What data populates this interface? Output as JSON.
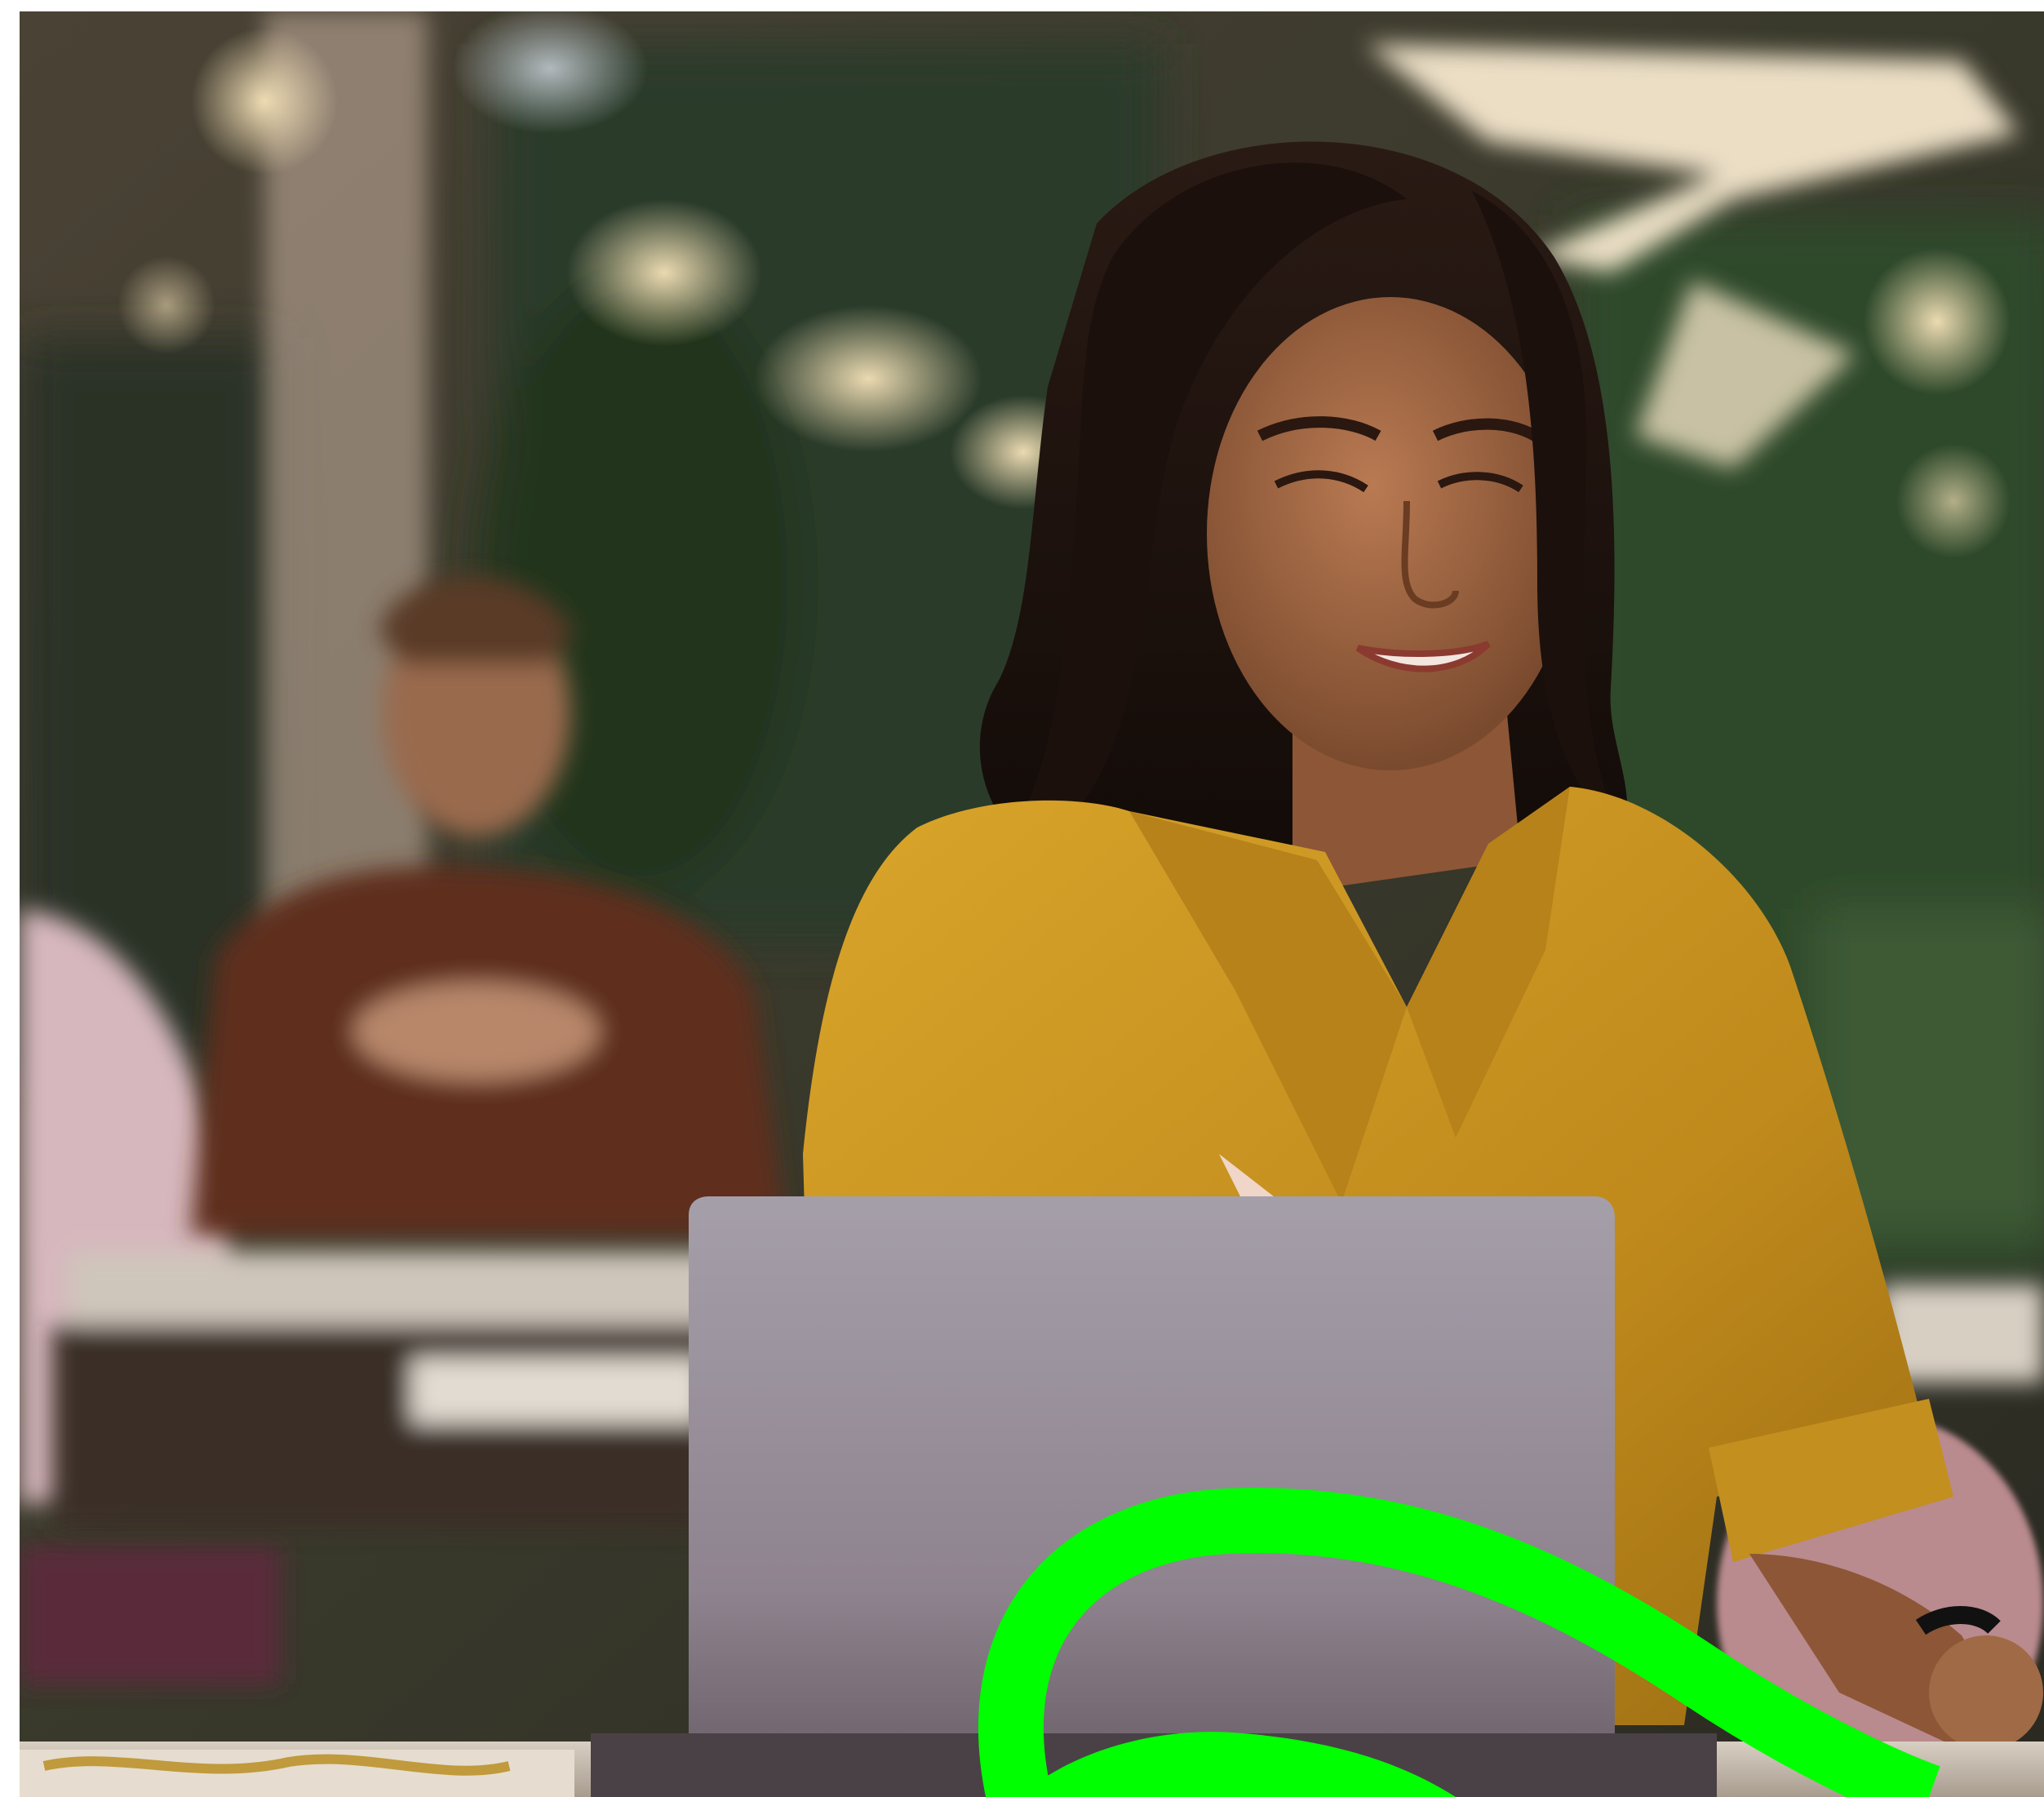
{
  "image": {
    "scene": "office",
    "colors": {
      "accent_ribbon": "#00ff00",
      "shirt": "#c8951e",
      "laptop": "#9a909a",
      "background_dark": "#2e2a22",
      "foliage": "#2f4a2c",
      "page_background": "#ffffff"
    },
    "icons": [
      "green-ribbon-graphic",
      "neon-arrow-sign"
    ]
  }
}
